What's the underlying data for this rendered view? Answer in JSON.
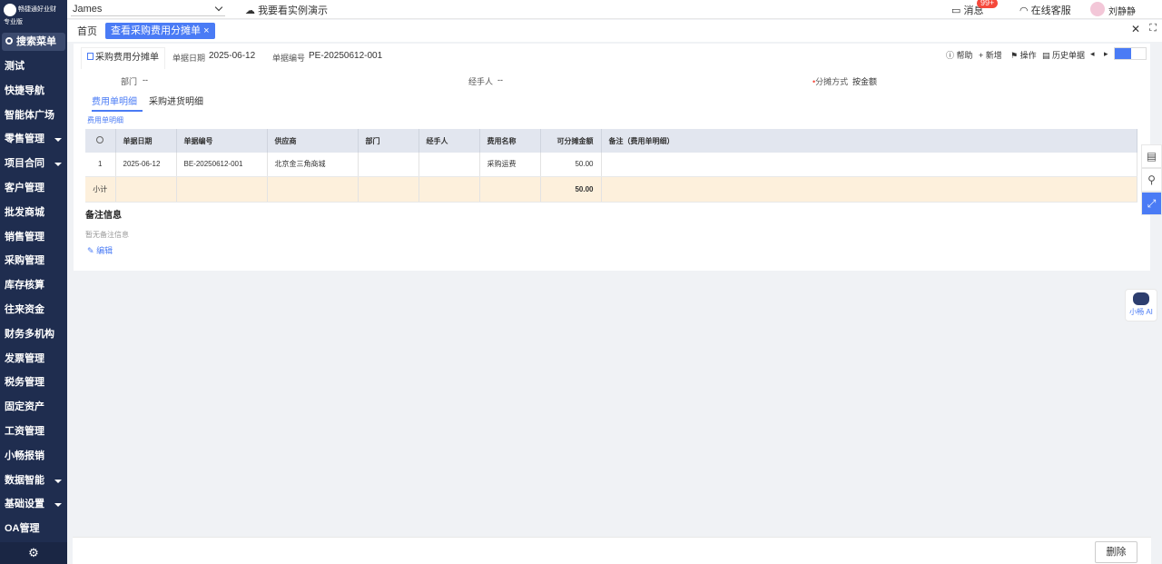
{
  "app": {
    "logo_text": "畅捷通好业财",
    "edition": "专业版",
    "search_menu_label": "搜索菜单"
  },
  "sidebar": {
    "items": [
      {
        "label": "测试",
        "has_caret": false
      },
      {
        "label": "快捷导航",
        "has_caret": false
      },
      {
        "label": "智能体广场",
        "has_caret": false
      },
      {
        "label": "零售管理",
        "has_caret": true
      },
      {
        "label": "项目合同",
        "has_caret": true
      },
      {
        "label": "客户管理",
        "has_caret": false
      },
      {
        "label": "批发商城",
        "has_caret": false
      },
      {
        "label": "销售管理",
        "has_caret": false
      },
      {
        "label": "采购管理",
        "has_caret": false
      },
      {
        "label": "库存核算",
        "has_caret": false
      },
      {
        "label": "往来资金",
        "has_caret": false
      },
      {
        "label": "财务多机构",
        "has_caret": false
      },
      {
        "label": "发票管理",
        "has_caret": false
      },
      {
        "label": "税务管理",
        "has_caret": false
      },
      {
        "label": "固定资产",
        "has_caret": false
      },
      {
        "label": "工资管理",
        "has_caret": false
      },
      {
        "label": "小畅报销",
        "has_caret": false
      },
      {
        "label": "数据智能",
        "has_caret": true
      },
      {
        "label": "基础设置",
        "has_caret": true
      },
      {
        "label": "OA管理",
        "has_caret": false
      }
    ],
    "settings_icon": "⚙"
  },
  "topbar": {
    "account_name": "James",
    "demo_link": "我要看实例演示",
    "messages_label": "消息",
    "messages_badge": "99+",
    "support_label": "在线客服",
    "user_name": "刘静静"
  },
  "tabs": {
    "home": "首页",
    "active": "查看采购费用分摊单",
    "active_close": "×",
    "close_all": "✕",
    "fullscreen": "⛶"
  },
  "doc": {
    "title": "采购费用分摊单",
    "date_label": "单据日期",
    "date_value": "2025-06-12",
    "number_label": "单据编号",
    "number_value": "PE-20250612-001",
    "toolbar": {
      "help": "帮助",
      "new": "新增",
      "operate": "操作",
      "history": "历史单据"
    },
    "info": {
      "dept_label": "部门",
      "dept_value": "--",
      "handler_label": "经手人",
      "handler_value": "--",
      "method_label": "分摊方式",
      "method_value": "按金额"
    },
    "sub_tabs": {
      "expense": "费用单明细",
      "purchase": "采购进货明细"
    },
    "section_link": "费用单明细"
  },
  "grid": {
    "headers": [
      "单据日期",
      "单据编号",
      "供应商",
      "部门",
      "经手人",
      "费用名称",
      "可分摊金额",
      "备注（费用单明细）"
    ],
    "rows": [
      {
        "idx": "1",
        "date": "2025-06-12",
        "number": "BE-20250612-001",
        "supplier": "北京金三角商城",
        "dept": "",
        "handler": "",
        "expense": "采购运费",
        "amount": "50.00",
        "remark": ""
      }
    ],
    "subtotal_label": "小计",
    "subtotal_amount": "50.00"
  },
  "remarks": {
    "title": "备注信息",
    "empty": "暂无备注信息",
    "edit": "编辑"
  },
  "ai": {
    "label": "小畅 AI"
  },
  "footer": {
    "delete": "删除"
  }
}
